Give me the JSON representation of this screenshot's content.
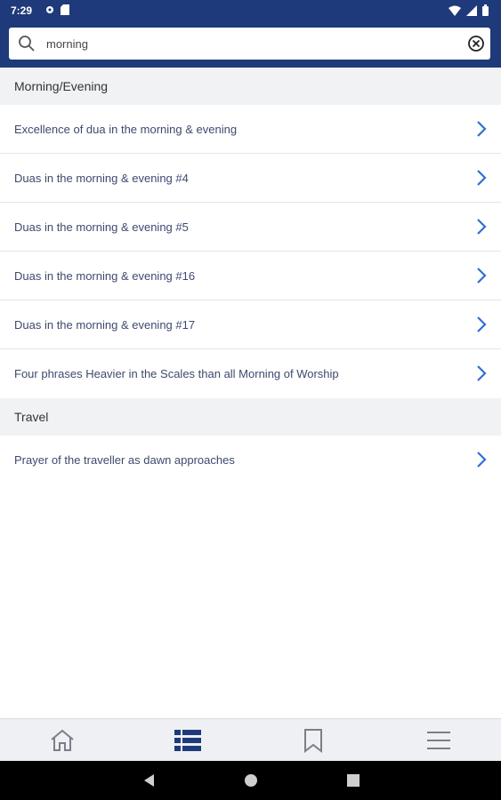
{
  "status_bar": {
    "time": "7:29"
  },
  "search": {
    "value": "morning",
    "placeholder": ""
  },
  "sections": [
    {
      "header": "Morning/Evening",
      "items": [
        "Excellence of dua in the morning & evening",
        "Duas in the morning & evening #4",
        "Duas in the morning & evening #5",
        "Duas in the morning & evening #16",
        "Duas in the morning & evening #17",
        "Four phrases Heavier in the Scales than all Morning of Worship"
      ]
    },
    {
      "header": "Travel",
      "items": [
        "Prayer of the traveller as dawn approaches"
      ]
    }
  ],
  "bottom_nav": [
    {
      "icon": "home-icon",
      "active": false
    },
    {
      "icon": "list-icon",
      "active": true
    },
    {
      "icon": "bookmark-icon",
      "active": false
    },
    {
      "icon": "menu-icon",
      "active": false
    }
  ],
  "colors": {
    "header": "#1f3a7a",
    "accent": "#2f6fd6",
    "active_nav": "#1f3a7a",
    "inactive_nav": "#7a7f89"
  }
}
